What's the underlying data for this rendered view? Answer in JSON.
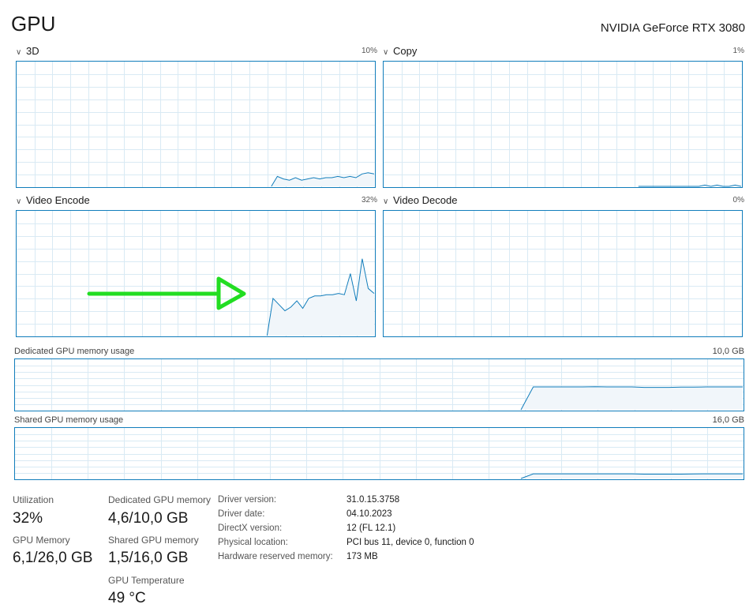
{
  "header": {
    "title": "GPU",
    "device_name": "NVIDIA GeForce RTX 3080"
  },
  "colors": {
    "graph_line": "#117dbb",
    "graph_fill": "#f1f6fa",
    "grid": "#d9eaf4",
    "arrow": "#22dd22"
  },
  "icons": {
    "collapse": "chevron-down-icon"
  },
  "engines": [
    {
      "name": "3D",
      "percent": "10%"
    },
    {
      "name": "Copy",
      "percent": "1%"
    },
    {
      "name": "Video Encode",
      "percent": "32%"
    },
    {
      "name": "Video Decode",
      "percent": "0%"
    }
  ],
  "memory_graphs": [
    {
      "label": "Dedicated GPU memory usage",
      "max": "10,0 GB"
    },
    {
      "label": "Shared GPU memory usage",
      "max": "16,0 GB"
    }
  ],
  "chart_data": [
    {
      "type": "area",
      "title": "3D",
      "ylim": [
        0,
        100
      ],
      "x": [
        0,
        1,
        2,
        3,
        4,
        5,
        6,
        7,
        8,
        9,
        10,
        11,
        12,
        13,
        14,
        15,
        16,
        17,
        18,
        19,
        20,
        21,
        22,
        23,
        24,
        25,
        26,
        27,
        28,
        29,
        30,
        31,
        32,
        33,
        34,
        35,
        36,
        37,
        38,
        39,
        40,
        41,
        42,
        43,
        44,
        45,
        46,
        47,
        48,
        49,
        50,
        51,
        52,
        53,
        54,
        55,
        56,
        57,
        58,
        59
      ],
      "series": [
        {
          "values": [
            null,
            null,
            null,
            null,
            null,
            null,
            null,
            null,
            null,
            null,
            null,
            null,
            null,
            null,
            null,
            null,
            null,
            null,
            null,
            null,
            null,
            null,
            null,
            null,
            null,
            null,
            null,
            null,
            null,
            null,
            null,
            null,
            null,
            null,
            null,
            null,
            null,
            null,
            null,
            null,
            null,
            null,
            0,
            8,
            6,
            5,
            7,
            5,
            6,
            7,
            6,
            7,
            7,
            8,
            7,
            8,
            7,
            10,
            11,
            10
          ]
        }
      ]
    },
    {
      "type": "area",
      "title": "Copy",
      "ylim": [
        0,
        100
      ],
      "x": [
        0,
        1,
        2,
        3,
        4,
        5,
        6,
        7,
        8,
        9,
        10,
        11,
        12,
        13,
        14,
        15,
        16,
        17,
        18,
        19,
        20,
        21,
        22,
        23,
        24,
        25,
        26,
        27,
        28,
        29,
        30,
        31,
        32,
        33,
        34,
        35,
        36,
        37,
        38,
        39,
        40,
        41,
        42,
        43,
        44,
        45,
        46,
        47,
        48,
        49,
        50,
        51,
        52,
        53,
        54,
        55,
        56,
        57,
        58,
        59
      ],
      "series": [
        {
          "values": [
            null,
            null,
            null,
            null,
            null,
            null,
            null,
            null,
            null,
            null,
            null,
            null,
            null,
            null,
            null,
            null,
            null,
            null,
            null,
            null,
            null,
            null,
            null,
            null,
            null,
            null,
            null,
            null,
            null,
            null,
            null,
            null,
            null,
            null,
            null,
            null,
            null,
            null,
            null,
            null,
            null,
            null,
            0,
            0,
            0,
            0,
            0,
            0,
            0,
            0,
            0,
            0,
            0,
            1,
            0,
            1,
            0,
            0,
            1,
            0
          ]
        }
      ]
    },
    {
      "type": "area",
      "title": "Video Encode",
      "ylim": [
        0,
        100
      ],
      "x": [
        0,
        1,
        2,
        3,
        4,
        5,
        6,
        7,
        8,
        9,
        10,
        11,
        12,
        13,
        14,
        15,
        16,
        17,
        18,
        19,
        20,
        21,
        22,
        23,
        24,
        25,
        26,
        27,
        28,
        29,
        30,
        31,
        32,
        33,
        34,
        35,
        36,
        37,
        38,
        39,
        40,
        41,
        42,
        43,
        44,
        45,
        46,
        47,
        48,
        49,
        50,
        51,
        52,
        53,
        54,
        55,
        56,
        57,
        58,
        59
      ],
      "series": [
        {
          "values": [
            null,
            null,
            null,
            null,
            null,
            null,
            null,
            null,
            null,
            null,
            null,
            null,
            null,
            null,
            null,
            null,
            null,
            null,
            null,
            null,
            null,
            null,
            null,
            null,
            null,
            null,
            null,
            null,
            null,
            null,
            null,
            null,
            null,
            null,
            null,
            null,
            null,
            null,
            null,
            null,
            null,
            null,
            0,
            30,
            25,
            20,
            23,
            28,
            22,
            30,
            32,
            32,
            33,
            33,
            34,
            33,
            50,
            28,
            62,
            38,
            34
          ]
        }
      ]
    },
    {
      "type": "area",
      "title": "Video Decode",
      "ylim": [
        0,
        100
      ],
      "x": [],
      "series": [
        {
          "values": []
        }
      ]
    },
    {
      "type": "area",
      "title": "Dedicated GPU memory usage",
      "ylim": [
        0,
        10
      ],
      "series": [
        {
          "values": [
            null,
            null,
            null,
            null,
            null,
            null,
            null,
            null,
            null,
            null,
            null,
            null,
            null,
            null,
            null,
            null,
            null,
            null,
            null,
            null,
            null,
            null,
            null,
            null,
            null,
            null,
            null,
            null,
            null,
            null,
            null,
            null,
            null,
            null,
            null,
            null,
            null,
            null,
            null,
            null,
            null,
            0,
            4.6,
            4.6,
            4.6,
            4.6,
            4.6,
            4.65,
            4.6,
            4.6,
            4.6,
            4.5,
            4.5,
            4.5,
            4.55,
            4.55,
            4.6,
            4.6,
            4.6,
            4.6
          ]
        }
      ]
    },
    {
      "type": "area",
      "title": "Shared GPU memory usage",
      "ylim": [
        0,
        16
      ],
      "series": [
        {
          "values": [
            null,
            null,
            null,
            null,
            null,
            null,
            null,
            null,
            null,
            null,
            null,
            null,
            null,
            null,
            null,
            null,
            null,
            null,
            null,
            null,
            null,
            null,
            null,
            null,
            null,
            null,
            null,
            null,
            null,
            null,
            null,
            null,
            null,
            null,
            null,
            null,
            null,
            null,
            null,
            null,
            null,
            0,
            1.5,
            1.5,
            1.5,
            1.5,
            1.5,
            1.5,
            1.5,
            1.5,
            1.5,
            1.4,
            1.4,
            1.4,
            1.4,
            1.45,
            1.5,
            1.5,
            1.5,
            1.5
          ]
        }
      ]
    }
  ],
  "stats": {
    "utilization": {
      "label": "Utilization",
      "value": "32%"
    },
    "gpu_memory": {
      "label": "GPU Memory",
      "value": "6,1/26,0 GB"
    },
    "dedicated": {
      "label": "Dedicated GPU memory",
      "value": "4,6/10,0 GB"
    },
    "shared": {
      "label": "Shared GPU memory",
      "value": "1,5/16,0 GB"
    },
    "temperature": {
      "label": "GPU Temperature",
      "value": "49 °C"
    }
  },
  "properties": [
    {
      "label": "Driver version:",
      "value": "31.0.15.3758"
    },
    {
      "label": "Driver date:",
      "value": "04.10.2023"
    },
    {
      "label": "DirectX version:",
      "value": "12 (FL 12.1)"
    },
    {
      "label": "Physical location:",
      "value": "PCI bus 11, device 0, function 0"
    },
    {
      "label": "Hardware reserved memory:",
      "value": "173 MB"
    }
  ]
}
